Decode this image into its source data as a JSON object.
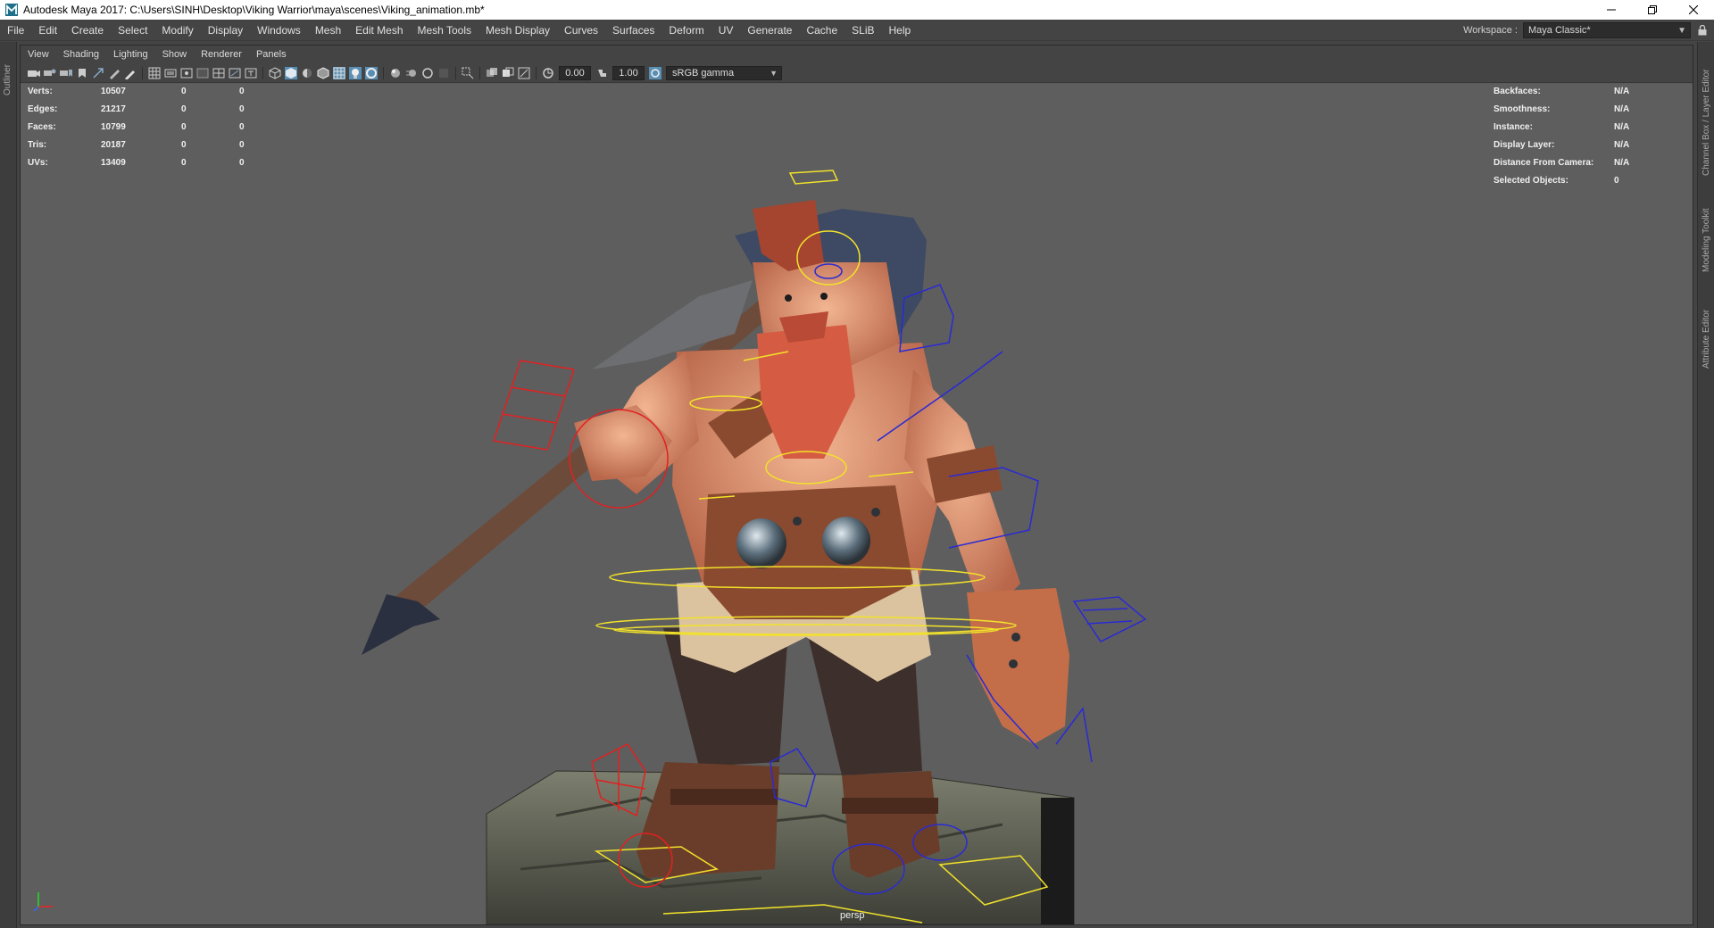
{
  "window": {
    "title": "Autodesk Maya 2017: C:\\Users\\SINH\\Desktop\\Viking Warrior\\maya\\scenes\\Viking_animation.mb*",
    "app_icon": "maya-logo-icon",
    "controls": [
      "minimize-icon",
      "restore-icon",
      "close-icon"
    ]
  },
  "menubar": {
    "items": [
      "File",
      "Edit",
      "Create",
      "Select",
      "Modify",
      "Display",
      "Windows",
      "Mesh",
      "Edit Mesh",
      "Mesh Tools",
      "Mesh Display",
      "Curves",
      "Surfaces",
      "Deform",
      "UV",
      "Generate",
      "Cache",
      "SLiB",
      "Help"
    ],
    "workspace_label": "Workspace :",
    "workspace_value": "Maya Classic*"
  },
  "side_tabs": {
    "left": [
      "Outliner"
    ],
    "right": [
      "Channel Box / Layer Editor",
      "Modeling Toolkit",
      "Attribute Editor"
    ]
  },
  "panel": {
    "menu": [
      "View",
      "Shading",
      "Lighting",
      "Show",
      "Renderer",
      "Panels"
    ],
    "toolbar": {
      "exposure": "0.00",
      "gamma": "1.00",
      "color_space": "sRGB gamma"
    }
  },
  "hud": {
    "left": [
      {
        "label": "Verts:",
        "values": [
          "10507",
          "0",
          "0"
        ]
      },
      {
        "label": "Edges:",
        "values": [
          "21217",
          "0",
          "0"
        ]
      },
      {
        "label": "Faces:",
        "values": [
          "10799",
          "0",
          "0"
        ]
      },
      {
        "label": "Tris:",
        "values": [
          "20187",
          "0",
          "0"
        ]
      },
      {
        "label": "UVs:",
        "values": [
          "13409",
          "0",
          "0"
        ]
      }
    ],
    "right": [
      {
        "label": "Backfaces:",
        "value": "N/A"
      },
      {
        "label": "Smoothness:",
        "value": "N/A"
      },
      {
        "label": "Instance:",
        "value": "N/A"
      },
      {
        "label": "Display Layer:",
        "value": "N/A"
      },
      {
        "label": "Distance From Camera:",
        "value": "N/A"
      },
      {
        "label": "Selected Objects:",
        "value": "0"
      }
    ]
  },
  "viewport": {
    "camera": "persp"
  }
}
